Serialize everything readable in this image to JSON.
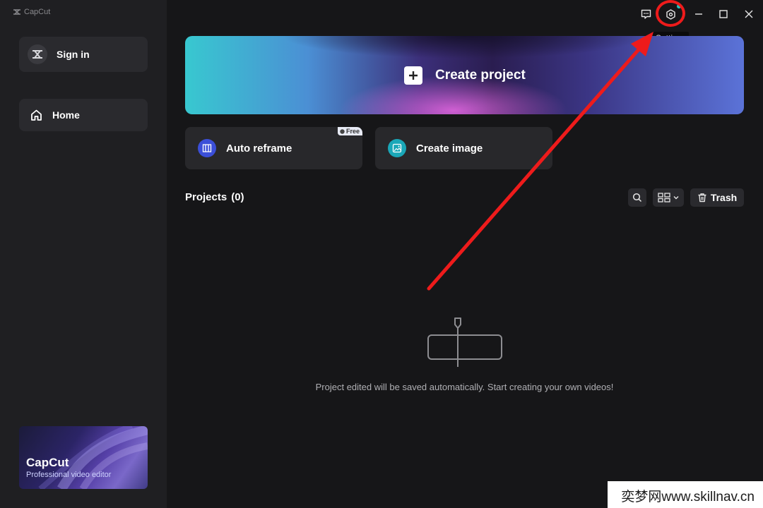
{
  "app": {
    "name": "CapCut"
  },
  "sidebar": {
    "signin_label": "Sign in",
    "home_label": "Home",
    "promo": {
      "title": "CapCut",
      "subtitle": "Professional video editor"
    }
  },
  "titlebar": {
    "tooltip": "Settings"
  },
  "main": {
    "create_project_label": "Create project",
    "tiles": [
      {
        "label": "Auto reframe",
        "badge": "Free",
        "icon": "reframe-icon",
        "color": "#3b4fd8"
      },
      {
        "label": "Create image",
        "icon": "image-icon",
        "color": "#1aa7b8"
      }
    ],
    "projects": {
      "title": "Projects",
      "count": "(0)",
      "trash_label": "Trash"
    },
    "empty_text": "Project edited will be saved automatically. Start creating your own videos!"
  },
  "watermark": "奕梦网www.skillnav.cn",
  "colors": {
    "accent_teal": "#25c3c0",
    "annotation_red": "#ee1b1b"
  }
}
